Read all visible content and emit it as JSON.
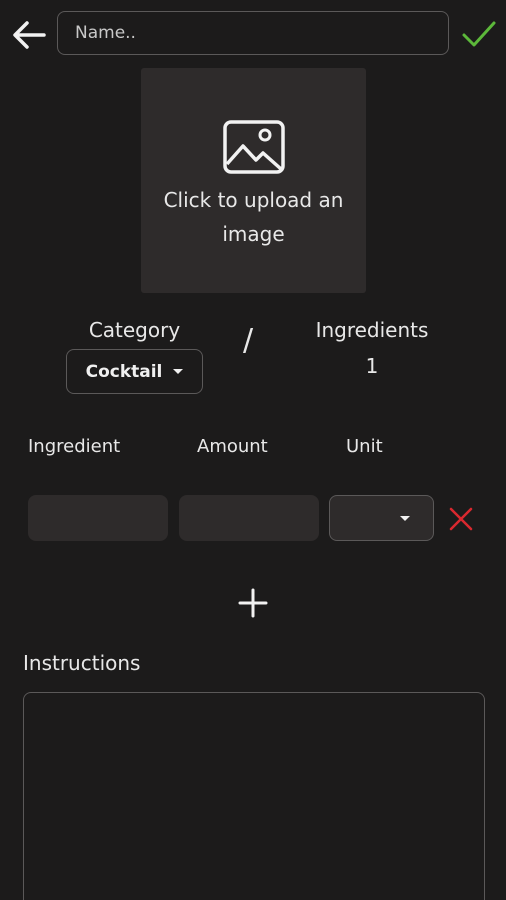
{
  "header": {
    "back_icon": "arrow-left-icon",
    "name_placeholder": "Name..",
    "name_value": "",
    "confirm_icon": "checkmark-icon",
    "confirm_color": "#5cb83a"
  },
  "image_upload": {
    "icon": "image-icon",
    "text": "Click to upload an image"
  },
  "category": {
    "label": "Category",
    "selected": "Cocktail"
  },
  "separator": "/",
  "ingredients_summary": {
    "label": "Ingredients",
    "count": "1"
  },
  "ingredient_table": {
    "columns": [
      "Ingredient",
      "Amount",
      "Unit"
    ],
    "rows": [
      {
        "ingredient": "",
        "amount": "",
        "unit": ""
      }
    ],
    "remove_icon": "close-icon",
    "remove_color": "#d9282f",
    "add_icon": "plus-icon"
  },
  "instructions": {
    "label": "Instructions",
    "value": ""
  },
  "colors": {
    "background": "#1c1b1b",
    "surface": "#2e2b2b",
    "border": "#5b5959",
    "text": "#e8e8e8"
  }
}
